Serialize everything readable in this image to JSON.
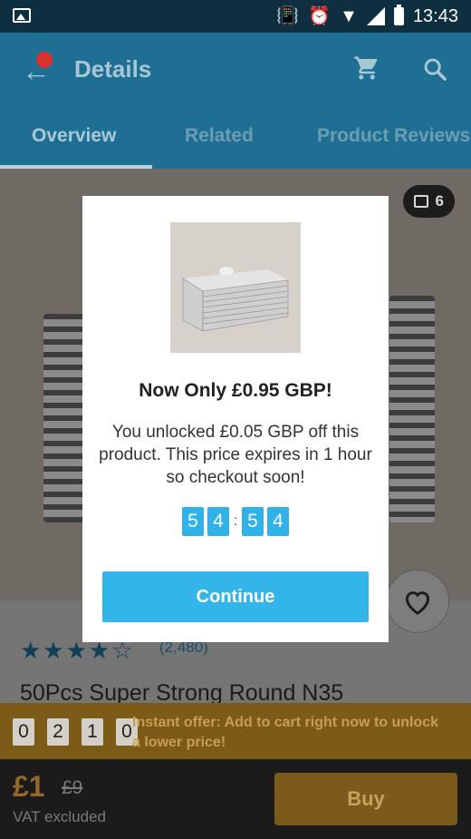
{
  "status_bar": {
    "time": "13:43"
  },
  "header": {
    "title": "Details",
    "tabs": [
      {
        "label": "Overview",
        "active": true
      },
      {
        "label": "Related",
        "active": false
      },
      {
        "label": "Product Reviews",
        "active": false
      }
    ]
  },
  "product": {
    "photo_count": "6",
    "rating_stars": "★★★★☆",
    "rating_count": "(2,480)",
    "title": "50Pcs Super Strong Round N35"
  },
  "instant_offer": {
    "countdown": [
      "0",
      "2",
      "1",
      "0"
    ],
    "text": "Instant offer: Add to cart right now to unlock a lower price!"
  },
  "buy_bar": {
    "price": "£1",
    "old_price": "£9",
    "vat_note": "VAT excluded",
    "buy_label": "Buy"
  },
  "modal": {
    "title": "Now Only £0.95 GBP!",
    "body": "You unlocked £0.05 GBP off this product. This price expires in 1 hour so checkout soon!",
    "countdown": [
      "5",
      "4",
      "5",
      "4"
    ],
    "continue_label": "Continue"
  },
  "colors": {
    "header": "#1e6f93",
    "accent_blue": "#33b5ea",
    "offer_bar": "#7c5a17",
    "buy_button": "#7b5a1c"
  }
}
